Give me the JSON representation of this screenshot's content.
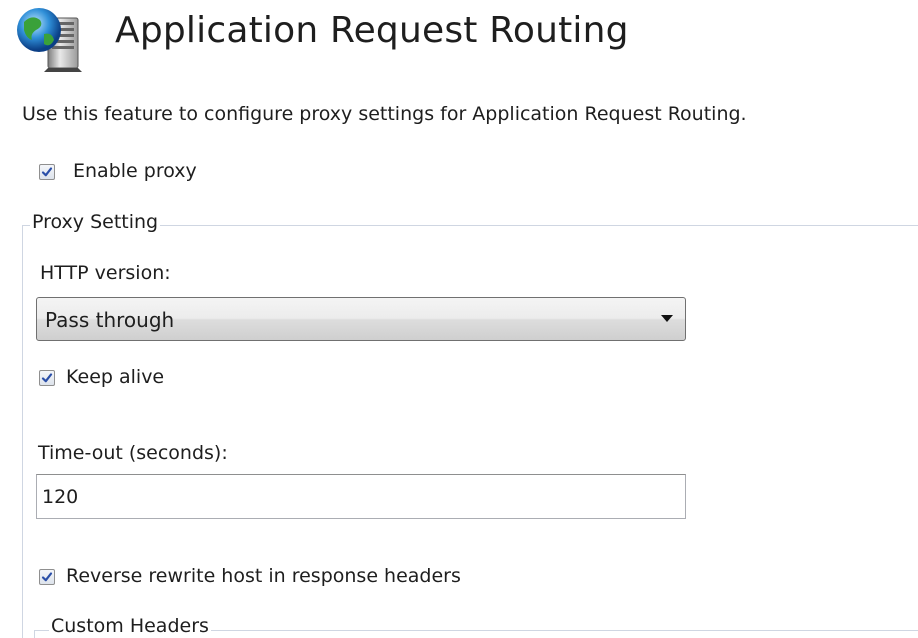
{
  "page": {
    "title": "Application Request Routing",
    "description": "Use this feature to configure proxy settings for Application Request Routing."
  },
  "enable_proxy": {
    "label": "Enable proxy",
    "checked": true
  },
  "proxy_setting": {
    "group_label": "Proxy Setting",
    "http_version": {
      "label": "HTTP version:",
      "selected": "Pass through"
    },
    "keep_alive": {
      "label": "Keep alive",
      "checked": true
    },
    "timeout": {
      "label": "Time-out (seconds):",
      "value": "120"
    },
    "reverse_rewrite": {
      "label": "Reverse rewrite host in response headers",
      "checked": true
    },
    "custom_headers": {
      "group_label": "Custom Headers"
    }
  },
  "icons": {
    "logo": "globe-server-icon",
    "check": "check-icon",
    "dropdown": "chevron-down-icon"
  },
  "colors": {
    "check": "#2b4fa8",
    "group_border": "#cfd6e2"
  }
}
